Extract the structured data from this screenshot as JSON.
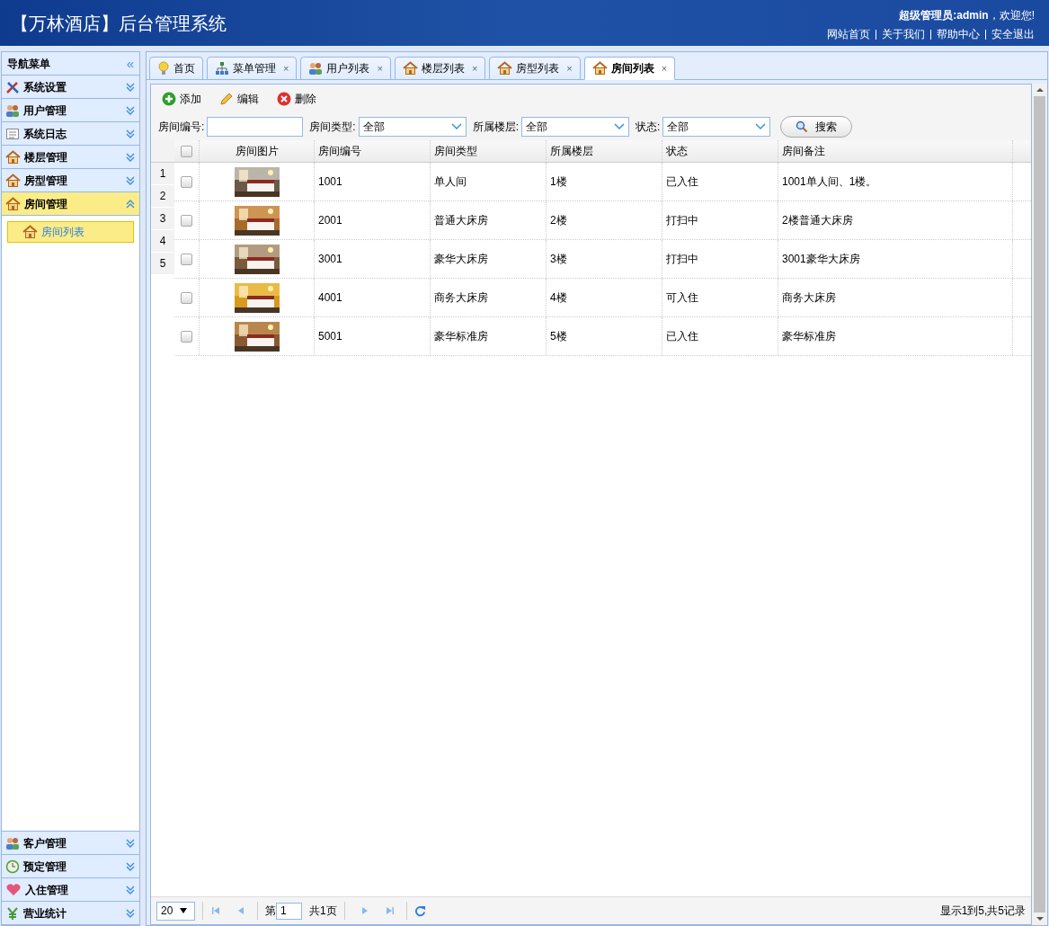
{
  "header": {
    "title": "【万林酒店】后台管理系统",
    "welcome_user": "超级管理员:admin",
    "welcome_suffix": "，欢迎您!",
    "links": [
      "网站首页",
      "关于我们",
      "帮助中心",
      "安全退出"
    ]
  },
  "sidebar": {
    "title": "导航菜单",
    "collapse_icon": "«",
    "top_sections": [
      {
        "label": "系统设置",
        "expanded": false
      },
      {
        "label": "用户管理",
        "expanded": false
      },
      {
        "label": "系统日志",
        "expanded": false
      },
      {
        "label": "楼层管理",
        "expanded": false
      },
      {
        "label": "房型管理",
        "expanded": false
      },
      {
        "label": "房间管理",
        "expanded": true,
        "children": [
          {
            "label": "房间列表",
            "selected": true
          }
        ]
      }
    ],
    "bottom_sections": [
      {
        "label": "客户管理",
        "expanded": false
      },
      {
        "label": "预定管理",
        "expanded": false
      },
      {
        "label": "入住管理",
        "expanded": false
      },
      {
        "label": "营业统计",
        "expanded": false
      }
    ]
  },
  "tabs": [
    {
      "label": "首页",
      "selected": false
    },
    {
      "label": "菜单管理",
      "close": "×",
      "selected": false
    },
    {
      "label": "用户列表",
      "close": "×",
      "selected": false
    },
    {
      "label": "楼层列表",
      "close": "×",
      "selected": false
    },
    {
      "label": "房型列表",
      "close": "×",
      "selected": false
    },
    {
      "label": "房间列表",
      "close": "×",
      "selected": true
    }
  ],
  "toolbar": [
    {
      "label": "添加",
      "kind": "add"
    },
    {
      "label": "编辑",
      "kind": "edit"
    },
    {
      "label": "删除",
      "kind": "delete"
    }
  ],
  "filters": [
    {
      "label": "房间编号:",
      "kind": "text"
    },
    {
      "label": "房间类型:",
      "kind": "select",
      "value": "全部"
    },
    {
      "label": "所属楼层:",
      "kind": "select",
      "value": "全部"
    },
    {
      "label": "状态:",
      "kind": "select",
      "value": "全部"
    }
  ],
  "search_button": "搜索",
  "table": {
    "columns": [
      "房间图片",
      "房间编号",
      "房间类型",
      "所属楼层",
      "状态",
      "房间备注"
    ],
    "header_checked": false,
    "row_numbers": [
      "1",
      "2",
      "3",
      "4",
      "5"
    ],
    "rows": [
      {
        "checked": false,
        "number": "1001",
        "type": "单人间",
        "floor": "1楼",
        "status": "已入住",
        "note": "1001单人间、1楼。"
      },
      {
        "checked": false,
        "number": "2001",
        "type": "普通大床房",
        "floor": "2楼",
        "status": "打扫中",
        "note": "2楼普通大床房"
      },
      {
        "checked": false,
        "number": "3001",
        "type": "豪华大床房",
        "floor": "3楼",
        "status": "打扫中",
        "note": "3001豪华大床房"
      },
      {
        "checked": false,
        "number": "4001",
        "type": "商务大床房",
        "floor": "4楼",
        "status": "可入住",
        "note": "商务大床房"
      },
      {
        "checked": false,
        "number": "5001",
        "type": "豪华标准房",
        "floor": "5楼",
        "status": "已入住",
        "note": "豪华标准房"
      }
    ]
  },
  "pagination": {
    "page_size": "20",
    "page_prefix": "第",
    "page": "1",
    "page_suffix": "共1页",
    "summary": "显示1到5,共5记录"
  }
}
